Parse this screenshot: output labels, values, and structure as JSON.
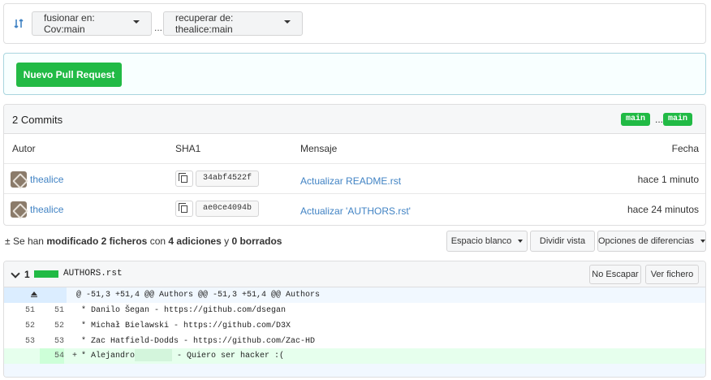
{
  "compare": {
    "base_label": "fusionar en: Cov:main",
    "separator": "...",
    "head_label": "recuperar de: thealice:main"
  },
  "new_pr": {
    "button_label": "Nuevo Pull Request"
  },
  "commits": {
    "title": "2 Commits",
    "branch_from": "main",
    "branch_sep": "...",
    "branch_to": "main",
    "columns": {
      "author": "Autor",
      "sha": "SHA1",
      "message": "Mensaje",
      "date": "Fecha"
    },
    "rows": [
      {
        "author": "thealice",
        "sha": "34abf4522f",
        "message": "Actualizar README.rst",
        "date": "hace 1 minuto"
      },
      {
        "author": "thealice",
        "sha": "ae0ce4094b",
        "message": "Actualizar 'AUTHORS.rst'",
        "date": "hace 24 minutos"
      }
    ]
  },
  "diff_stats": {
    "prefix": "Se han",
    "modified": "modificado 2 ficheros",
    "with": "con",
    "additions": "4 adiciones",
    "and": "y",
    "deletions": "0 borrados"
  },
  "diff_controls": {
    "whitespace": "Espacio blanco",
    "split": "Dividir vista",
    "options": "Opciones de diferencias"
  },
  "file": {
    "count": "1",
    "name": "AUTHORS.rst",
    "no_escape": "No Escapar",
    "view_file": "Ver fichero",
    "hunk": "@ -51,3 +51,4 @@ Authors @@ -51,3 +51,4 @@ Authors",
    "lines": [
      {
        "old": "51",
        "new": "51",
        "sign": "",
        "code": "* Danilo Šegan - https://github.com/dsegan"
      },
      {
        "old": "52",
        "new": "52",
        "sign": "",
        "code": "* Michał Bielawski - https://github.com/D3X"
      },
      {
        "old": "53",
        "new": "53",
        "sign": "",
        "code": "* Zac Hatfield-Dodds - https://github.com/Zac-HD"
      }
    ],
    "added": {
      "old": "",
      "new": "54",
      "sign": "+",
      "code_start": "* Alejandro",
      "code_end": " - Quiero ser hacker :("
    }
  },
  "colors": {
    "accent_green": "#21ba45",
    "link_blue": "#4183c4"
  }
}
